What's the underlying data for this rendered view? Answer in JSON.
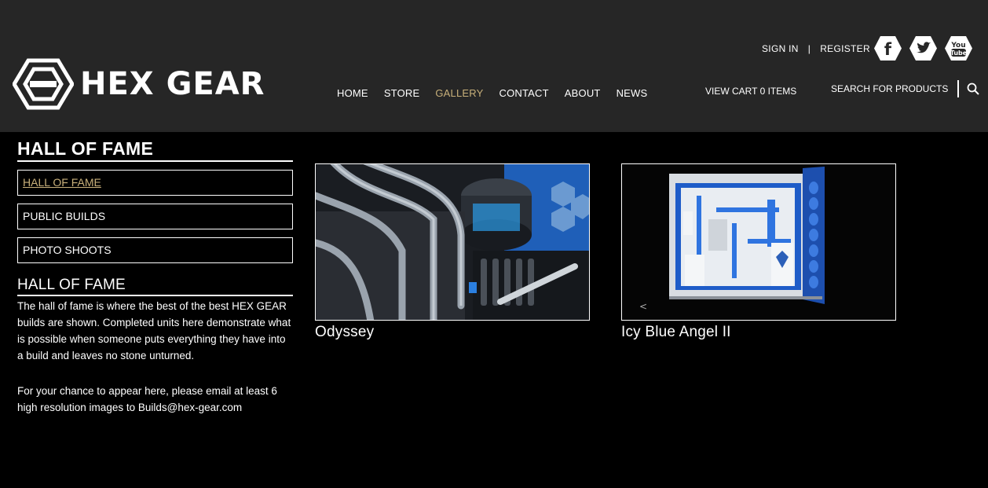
{
  "header": {
    "brand": "HEX GEAR",
    "sign_in": "SIGN IN",
    "divider": "|",
    "register": "REGISTER",
    "social": [
      {
        "icon": "facebook-icon",
        "glyph": "f"
      },
      {
        "icon": "twitter-icon",
        "glyph": ""
      },
      {
        "icon": "youtube-icon",
        "glyph": "You Tube"
      }
    ],
    "nav": [
      {
        "label": "HOME",
        "active": false
      },
      {
        "label": "STORE",
        "active": false
      },
      {
        "label": "GALLERY",
        "active": true
      },
      {
        "label": "CONTACT",
        "active": false
      },
      {
        "label": "ABOUT",
        "active": false
      },
      {
        "label": "NEWS",
        "active": false
      }
    ],
    "cart": "VIEW CART 0 ITEMS",
    "search_label": "SEARCH FOR PRODUCTS"
  },
  "sidebar": {
    "title": "HALL OF FAME",
    "buttons": [
      {
        "label": "HALL OF FAME",
        "active": true
      },
      {
        "label": "PUBLIC BUILDS",
        "active": false
      },
      {
        "label": "PHOTO SHOOTS",
        "active": false
      }
    ],
    "section_title": "HALL OF FAME",
    "para1": "The hall of fame is where the best of the best HEX GEAR builds are shown. Completed units here demonstrate what is possible when someone puts everything they have into a build and leaves no stone unturned.",
    "para2": "For your chance to appear here, please email at least 6 high resolution images to Builds@hex-gear.com"
  },
  "gallery": [
    {
      "title": "Odyssey"
    },
    {
      "title": "Icy Blue Angel II"
    }
  ],
  "colors": {
    "accent": "#c8b07a",
    "header_bg": "#262626",
    "page_bg": "#000000"
  }
}
